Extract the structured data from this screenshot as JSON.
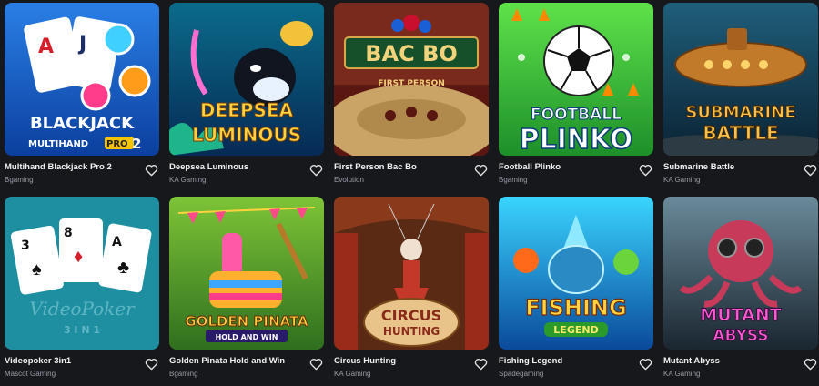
{
  "games": [
    {
      "title": "Multihand Blackjack Pro 2",
      "provider": "Bgaming",
      "art": {
        "line1": "BLACKJACK",
        "line2": "MULTIHAND",
        "badge": "PRO",
        "num": "2"
      }
    },
    {
      "title": "Deepsea Luminous",
      "provider": "KA Gaming",
      "art": {
        "line1": "DEEPSEA",
        "line2": "LUMINOUS"
      }
    },
    {
      "title": "First Person Bac Bo",
      "provider": "Evolution",
      "art": {
        "line1": "BAC BO",
        "line2": "FIRST PERSON"
      }
    },
    {
      "title": "Football Plinko",
      "provider": "Bgaming",
      "art": {
        "line1": "FOOTBALL",
        "line2": "PLINKO"
      }
    },
    {
      "title": "Submarine Battle",
      "provider": "KA Gaming",
      "art": {
        "line1": "SUBMARINE",
        "line2": "BATTLE"
      }
    },
    {
      "title": "Videopoker 3in1",
      "provider": "Mascot Gaming",
      "art": {
        "line1": "VideoPoker",
        "line2": "3 I N 1",
        "c1": "3",
        "c2": "8",
        "c3": "A"
      }
    },
    {
      "title": "Golden Pinata Hold and Win",
      "provider": "Bgaming",
      "art": {
        "line1": "GOLDEN PINATA",
        "line2": "HOLD AND WIN"
      }
    },
    {
      "title": "Circus Hunting",
      "provider": "KA Gaming",
      "art": {
        "line1": "CIRCUS",
        "line2": "HUNTING"
      }
    },
    {
      "title": "Fishing Legend",
      "provider": "Spadegaming",
      "art": {
        "line1": "FISHING",
        "line2": "LEGEND"
      }
    },
    {
      "title": "Mutant Abyss",
      "provider": "KA Gaming",
      "art": {
        "line1": "MUTANT",
        "line2": "ABYSS"
      }
    }
  ]
}
